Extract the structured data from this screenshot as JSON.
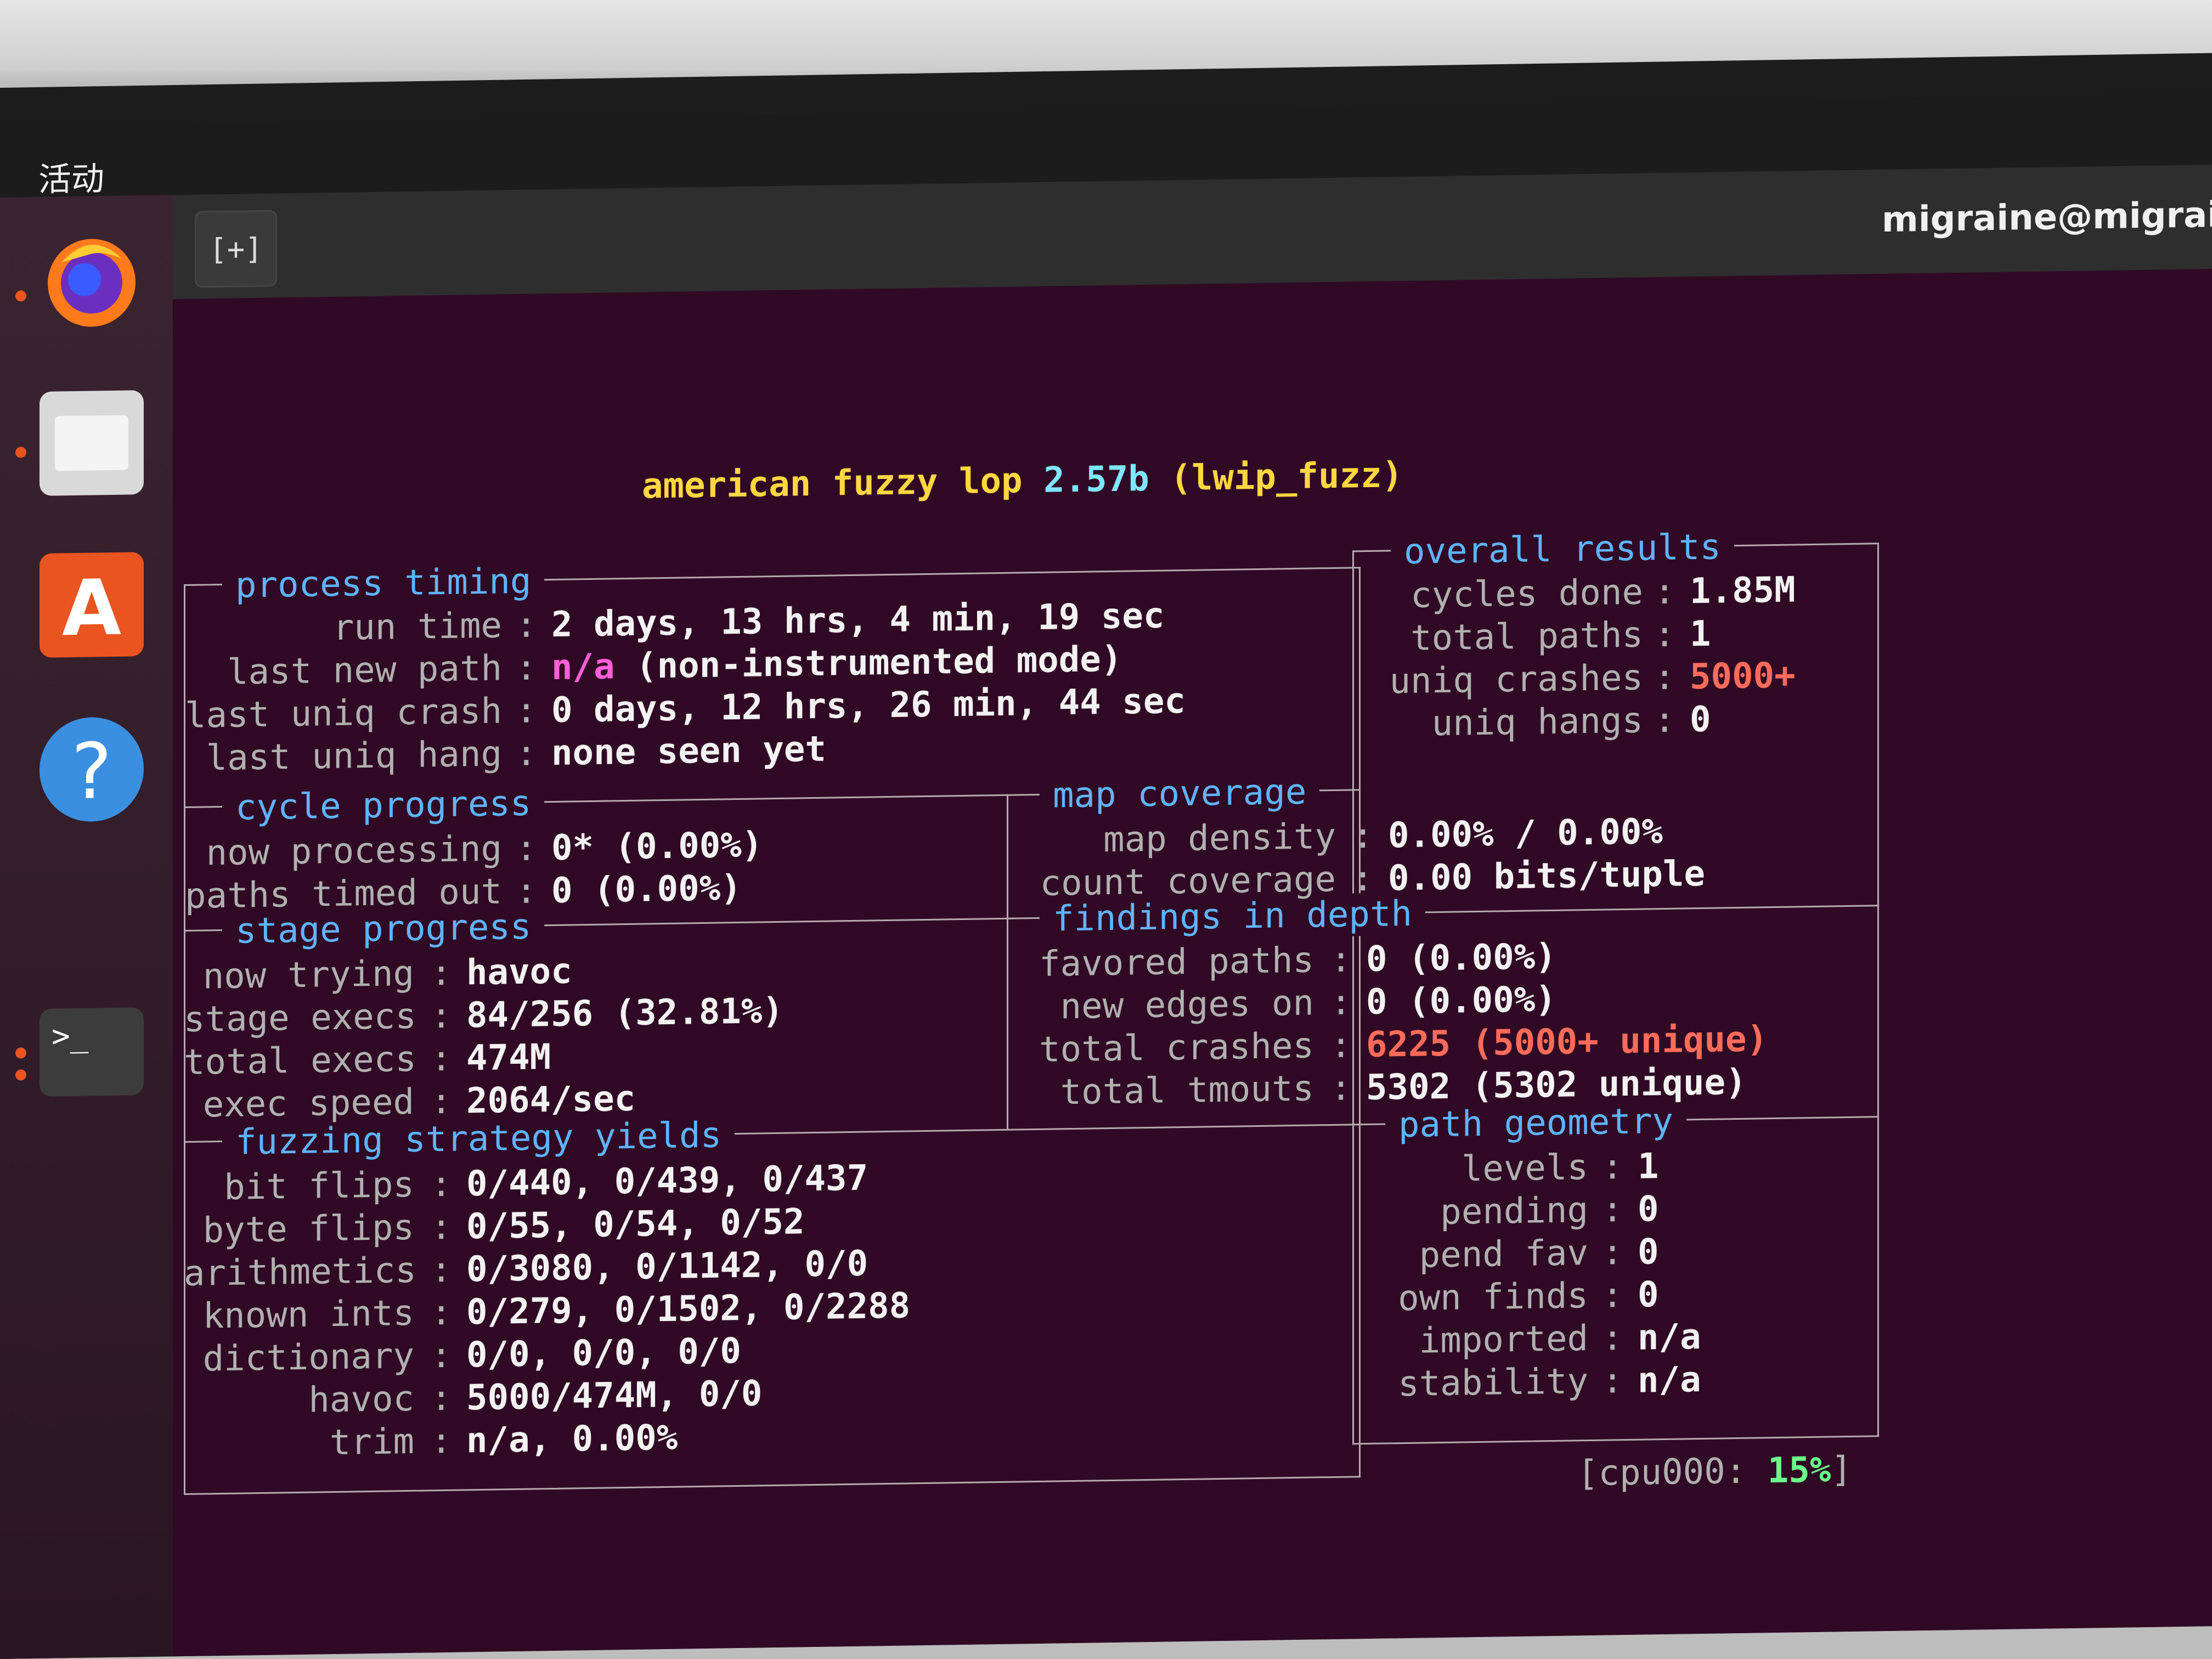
{
  "desktop": {
    "activities": "活动",
    "window_title": "migraine@migraine",
    "new_tab_icon": "new-tab-icon"
  },
  "dock": [
    {
      "name": "firefox",
      "icon": "firefox-icon"
    },
    {
      "name": "files",
      "icon": "folder-icon"
    },
    {
      "name": "software",
      "icon": "store-icon"
    },
    {
      "name": "help",
      "icon": "help-icon"
    },
    {
      "name": "terminal",
      "icon": "terminal-icon"
    }
  ],
  "afl": {
    "title_prefix": "american fuzzy lop",
    "version": "2.57b",
    "target": "(lwip_fuzz)",
    "process_timing": {
      "header": "process timing",
      "run_time_label": "run time",
      "run_time": "2 days, 13 hrs, 4 min, 19 sec",
      "last_new_path_label": "last new path",
      "last_new_path_na": "n/a",
      "last_new_path_note": "(non-instrumented mode)",
      "last_uniq_crash_label": "last uniq crash",
      "last_uniq_crash": "0 days, 12 hrs, 26 min, 44 sec",
      "last_uniq_hang_label": "last uniq hang",
      "last_uniq_hang": "none seen yet"
    },
    "overall_results": {
      "header": "overall results",
      "cycles_done_label": "cycles done",
      "cycles_done": "1.85M",
      "total_paths_label": "total paths",
      "total_paths": "1",
      "uniq_crashes_label": "uniq crashes",
      "uniq_crashes": "5000+",
      "uniq_hangs_label": "uniq hangs",
      "uniq_hangs": "0"
    },
    "cycle_progress": {
      "header": "cycle progress",
      "now_processing_label": "now processing",
      "now_processing": "0* (0.00%)",
      "paths_timed_out_label": "paths timed out",
      "paths_timed_out": "0 (0.00%)"
    },
    "map_coverage": {
      "header": "map coverage",
      "map_density_label": "map density",
      "map_density": "0.00% / 0.00%",
      "count_coverage_label": "count coverage",
      "count_coverage": "0.00 bits/tuple"
    },
    "stage_progress": {
      "header": "stage progress",
      "now_trying_label": "now trying",
      "now_trying": "havoc",
      "stage_execs_label": "stage execs",
      "stage_execs": "84/256 (32.81%)",
      "total_execs_label": "total execs",
      "total_execs": "474M",
      "exec_speed_label": "exec speed",
      "exec_speed": "2064/sec"
    },
    "findings_in_depth": {
      "header": "findings in depth",
      "favored_paths_label": "favored paths",
      "favored_paths": "0 (0.00%)",
      "new_edges_on_label": "new edges on",
      "new_edges_on": "0 (0.00%)",
      "total_crashes_label": "total crashes",
      "total_crashes": "6225 (5000+ unique)",
      "total_tmouts_label": "total tmouts",
      "total_tmouts": "5302 (5302 unique)"
    },
    "fuzzing_strategy_yields": {
      "header": "fuzzing strategy yields",
      "bit_flips_label": "bit flips",
      "bit_flips": "0/440, 0/439, 0/437",
      "byte_flips_label": "byte flips",
      "byte_flips": "0/55, 0/54, 0/52",
      "arithmetics_label": "arithmetics",
      "arithmetics": "0/3080, 0/1142, 0/0",
      "known_ints_label": "known ints",
      "known_ints": "0/279, 0/1502, 0/2288",
      "dictionary_label": "dictionary",
      "dictionary": "0/0, 0/0, 0/0",
      "havoc_label": "havoc",
      "havoc": "5000/474M, 0/0",
      "trim_label": "trim",
      "trim": "n/a, 0.00%"
    },
    "path_geometry": {
      "header": "path geometry",
      "levels_label": "levels",
      "levels": "1",
      "pending_label": "pending",
      "pending": "0",
      "pend_fav_label": "pend fav",
      "pend_fav": "0",
      "own_finds_label": "own finds",
      "own_finds": "0",
      "imported_label": "imported",
      "imported": "n/a",
      "stability_label": "stability",
      "stability": "n/a"
    },
    "cpu": {
      "prefix": "[cpu000:",
      "value": "15%",
      "suffix": "]"
    }
  }
}
